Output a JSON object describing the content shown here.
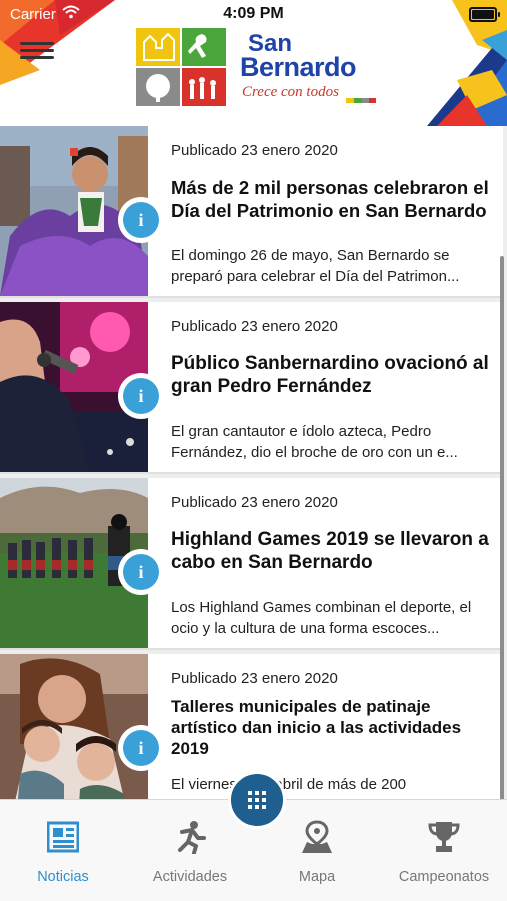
{
  "status_bar": {
    "carrier": "Carrier",
    "time": "4:09 PM"
  },
  "header": {
    "logo_line1": "San",
    "logo_line2": "Bernardo",
    "logo_tagline": "Crece con todos"
  },
  "news": [
    {
      "date": "Publicado 23 enero 2020",
      "title": "Más de 2 mil personas celebraron el Día del Patrimonio en San Bernardo",
      "excerpt": "El domingo 26 de mayo, San Bernardo se preparó para celebrar el Día del Patrimon..."
    },
    {
      "date": "Publicado 23 enero 2020",
      "title": "Público Sanbernardino ovacionó al gran Pedro Fernández",
      "excerpt": "El gran cantautor e ídolo azteca, Pedro Fernández, dio el broche de oro con un e..."
    },
    {
      "date": "Publicado 23 enero 2020",
      "title": "Highland Games 2019 se llevaron a cabo en San Bernardo",
      "excerpt": "Los Highland Games combinan el deporte, el ocio y la cultura de una forma escoces..."
    },
    {
      "date": "Publicado 23 enero 2020",
      "title": "Talleres municipales de patinaje artístico dan inicio a las actividades 2019",
      "excerpt": "El viernes 5 de abril de más de 200"
    }
  ],
  "tabs": [
    {
      "label": "Noticias",
      "icon": "newspaper-icon",
      "active": true
    },
    {
      "label": "Actividades",
      "icon": "runner-icon",
      "active": false
    },
    {
      "label": "Mapa",
      "icon": "map-pin-icon",
      "active": false
    },
    {
      "label": "Campeonatos",
      "icon": "trophy-icon",
      "active": false
    }
  ],
  "colors": {
    "accent": "#2e8fd0",
    "info_button": "#3aa0d8",
    "fab": "#1e5f8f",
    "brand_blue": "#1f43a8",
    "brand_red": "#c63a2a"
  }
}
